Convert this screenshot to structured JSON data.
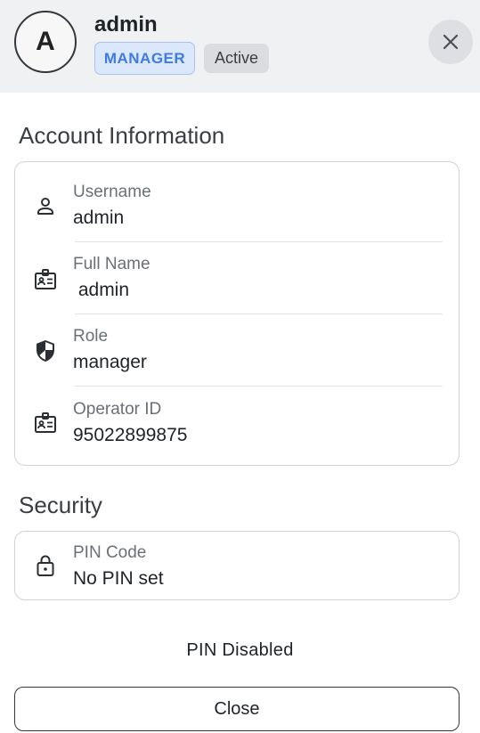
{
  "header": {
    "avatar_initial": "A",
    "name": "admin",
    "role_badge": "MANAGER",
    "status_badge": "Active"
  },
  "account_section": {
    "title": "Account Information",
    "fields": [
      {
        "label": "Username",
        "value": "admin",
        "icon": "person-icon"
      },
      {
        "label": "Full Name",
        "value": " admin",
        "icon": "id-badge-icon"
      },
      {
        "label": "Role",
        "value": "manager",
        "icon": "shield-icon"
      },
      {
        "label": "Operator ID",
        "value": "95022899875",
        "icon": "id-badge-icon"
      }
    ]
  },
  "security_section": {
    "title": "Security",
    "pin": {
      "label": "PIN Code",
      "value": "No PIN set",
      "icon": "lock-icon"
    }
  },
  "pin_status": "PIN Disabled",
  "actions": {
    "close_label": "Close"
  },
  "colors": {
    "accent": "#3f7be0",
    "badge_bg": "#dbe7fb",
    "header_bg": "#f0f1f3"
  }
}
